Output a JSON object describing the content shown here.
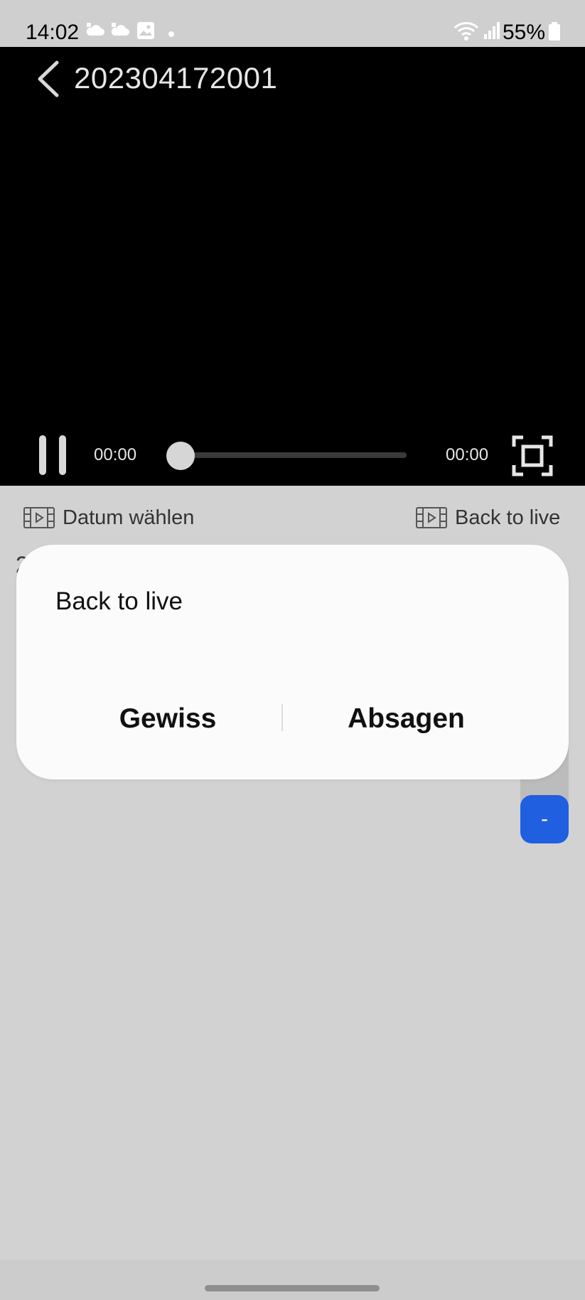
{
  "status_bar": {
    "time": "14:02",
    "battery": "55%",
    "icons": [
      "cloud-icon",
      "cloud-icon",
      "image-icon",
      "dot-icon",
      "wifi-icon",
      "signal-icon",
      "battery-icon"
    ]
  },
  "player": {
    "title": "202304172001",
    "current_time": "00:00",
    "total_time": "00:00",
    "progress": 0
  },
  "actions": {
    "choose_date": "Datum wählen",
    "back_to_live": "Back to live"
  },
  "background": {
    "partial_char": "2",
    "minus_label": "-"
  },
  "dialog": {
    "title": "Back to live",
    "confirm_label": "Gewiss",
    "cancel_label": "Absagen"
  },
  "colors": {
    "accent": "#1f5fe0",
    "video_bg": "#000000",
    "page_bg": "#d2d2d2"
  }
}
